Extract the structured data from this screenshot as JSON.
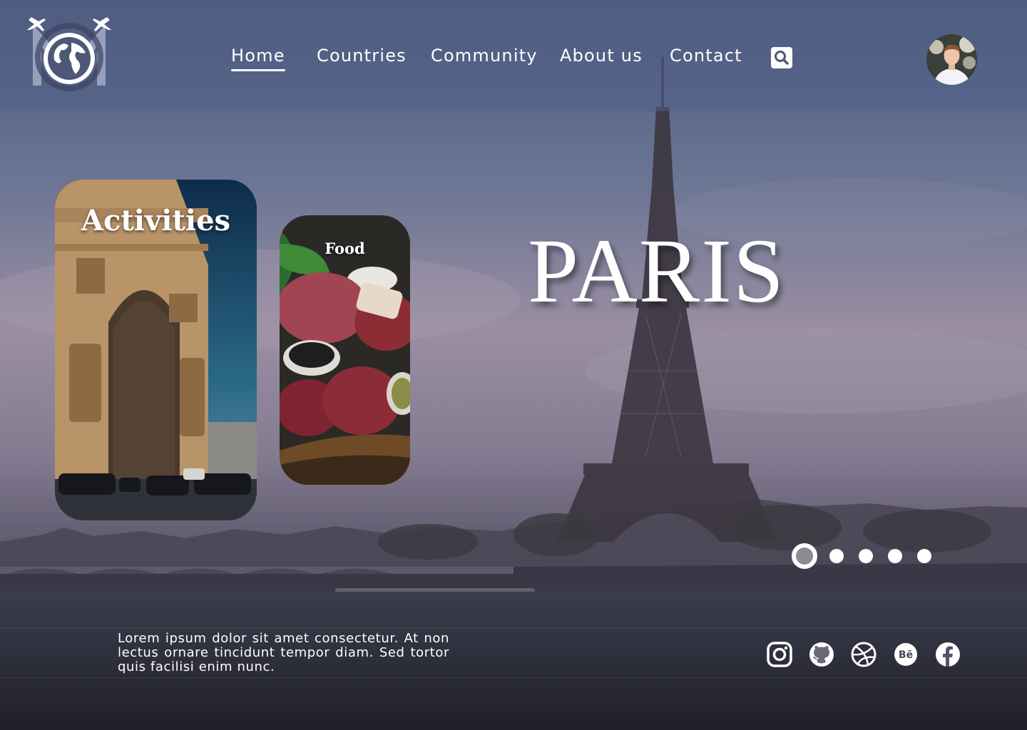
{
  "header": {
    "nav": [
      {
        "label": "Home",
        "active": true
      },
      {
        "label": "Countries",
        "active": false
      },
      {
        "label": "Community",
        "active": false
      },
      {
        "label": "About us",
        "active": false
      },
      {
        "label": "Contact",
        "active": false
      }
    ],
    "icons": {
      "search": "search-icon",
      "avatar": "user-avatar"
    }
  },
  "hero": {
    "title": "PARIS",
    "cards": [
      {
        "label": "Activities"
      },
      {
        "label": "Food"
      }
    ],
    "carousel": {
      "count": 5,
      "active_index": 0
    }
  },
  "footer": {
    "description": "Lorem ipsum dolor sit amet consectetur. At non lectus ornare tincidunt tempor diam. Sed tortor quis facilisi enim nunc.",
    "social": [
      "instagram-icon",
      "github-icon",
      "dribbble-icon",
      "behance-icon",
      "facebook-icon"
    ]
  },
  "colors": {
    "header_overlay": "#505f87",
    "accent": "#ffffff"
  }
}
